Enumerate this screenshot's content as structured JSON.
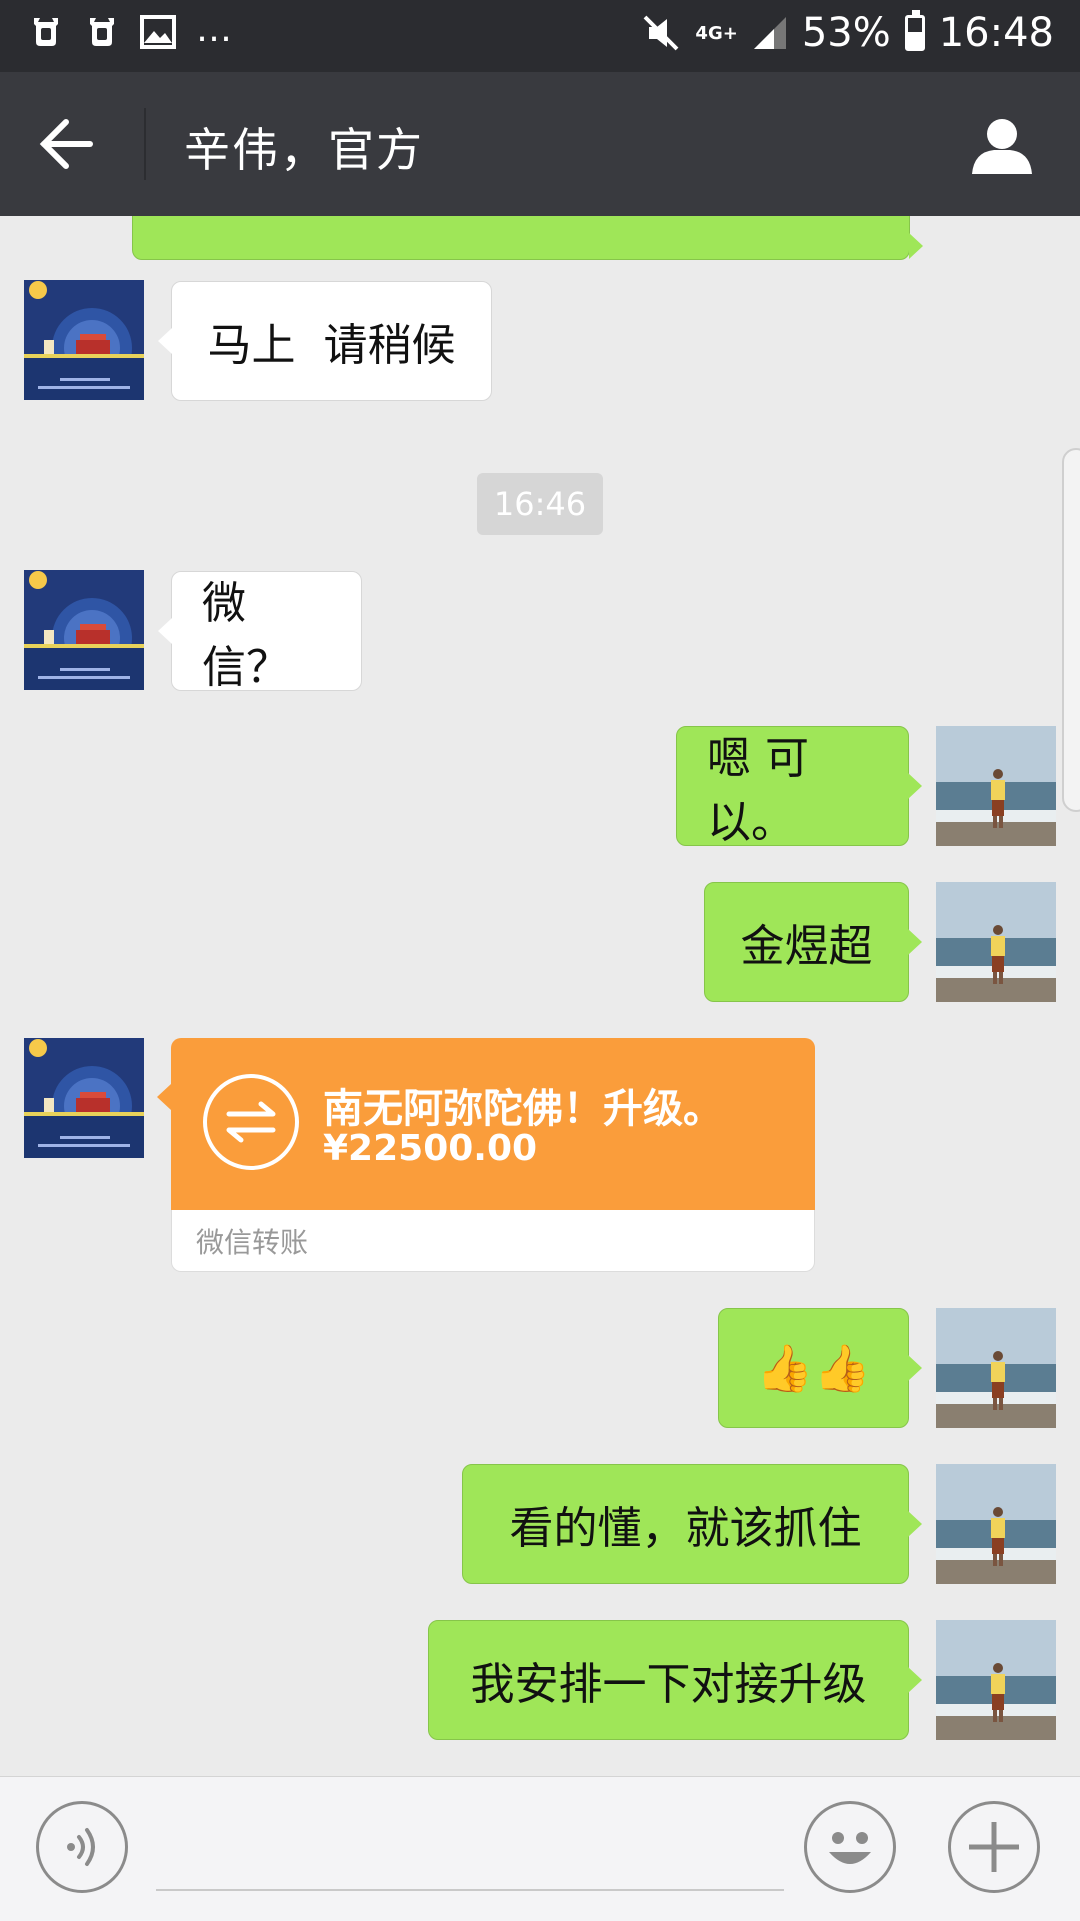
{
  "status_bar": {
    "left_icons": [
      "alarm-icon",
      "alarm-icon",
      "image-icon"
    ],
    "overflow": "…",
    "network": "4G+",
    "battery_percent": "53%",
    "battery_level": 0.53,
    "time": "16:48"
  },
  "title_bar": {
    "title": "辛伟，官方"
  },
  "chat": {
    "timestamp": "16:46",
    "messages": [
      {
        "side": "in",
        "text": "马上  请稍候"
      },
      {
        "side": "in",
        "text": "微信？"
      },
      {
        "side": "out",
        "text": "嗯 可以。"
      },
      {
        "side": "out",
        "text": "金煜超"
      },
      {
        "side": "out",
        "text": "👍👍"
      },
      {
        "side": "out",
        "text": "看的懂，就该抓住"
      },
      {
        "side": "out",
        "text": "我安排一下对接升级"
      }
    ],
    "transfer": {
      "title": "南无阿弥陀佛！升级。",
      "amount": "¥22500.00",
      "footer": "微信转账"
    }
  },
  "colors": {
    "outgoing_bubble": "#9fe658",
    "incoming_bubble": "#ffffff",
    "transfer_card": "#fa9d3b",
    "title_bar": "#393a3f",
    "status_bar": "#2b2c30",
    "chat_background": "#ebebeb"
  }
}
